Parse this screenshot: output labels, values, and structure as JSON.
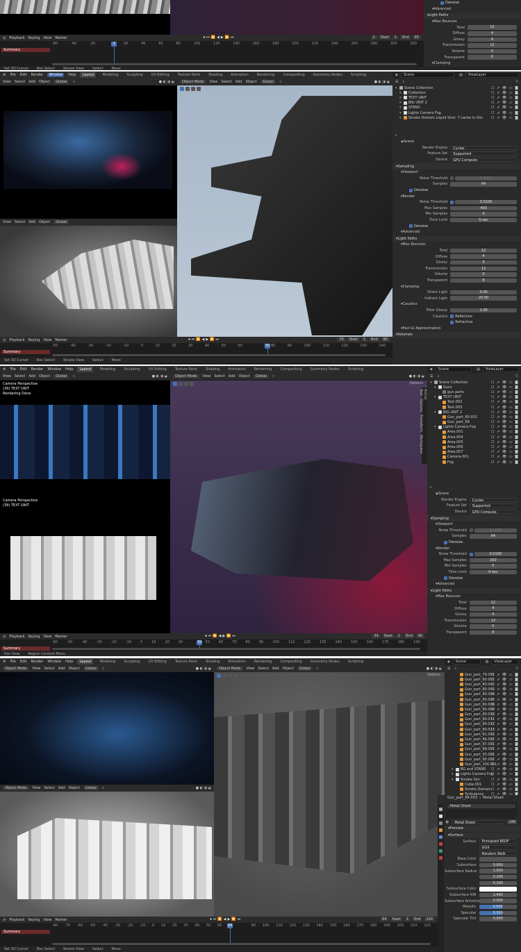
{
  "menu": [
    "File",
    "Edit",
    "Render",
    "Window",
    "Help"
  ],
  "workspaces": [
    "Layout",
    "Modeling",
    "Sculpting",
    "UV Editing",
    "Texture Paint",
    "Shading",
    "Animation",
    "Rendering",
    "Compositing",
    "Geometry Nodes",
    "Scripting"
  ],
  "header": {
    "view": "View",
    "select": "Select",
    "add": "Add",
    "object": "Object",
    "global": "Global",
    "object_mode": "Object Mode",
    "options": "Options",
    "scene": "Scene",
    "view_layer": "ViewLayer"
  },
  "timeline": {
    "playback": "Playback",
    "keying": "Keying",
    "view": "View",
    "marker": "Marker",
    "start_label": "Start",
    "end_label": "End",
    "summary": "Summary"
  },
  "status": {
    "set_3d_cursor": "Set 3D Cursor",
    "box_select": "Box Select",
    "rotate_view": "Rotate View",
    "select": "Select",
    "move": "Move",
    "pan_view": "Pan View",
    "region_context_menu": "Region Context Menu"
  },
  "colors": {
    "accent": "#4772b3",
    "summary": "#6b2a2a",
    "panel": "#2a2a2a"
  },
  "panels": [
    {
      "frame": {
        "current": "2",
        "start": "1",
        "end": "65"
      },
      "ticks": [
        "-60",
        "-40",
        "-20",
        "2",
        "20",
        "40",
        "60",
        "80",
        "100",
        "120",
        "140",
        "160",
        "180",
        "200",
        "220",
        "240",
        "260",
        "280",
        "300",
        "320"
      ],
      "current_fraction": 0.17,
      "props": [
        {
          "t": "chk",
          "label": "Denoise"
        },
        {
          "t": "sub",
          "label": "Advanced"
        },
        {
          "t": "sec",
          "label": "Light Paths"
        },
        {
          "t": "sub",
          "label": "Max Bounces"
        },
        {
          "t": "f",
          "label": "Total",
          "value": "12"
        },
        {
          "t": "f",
          "label": "Diffuse",
          "value": "4"
        },
        {
          "t": "f",
          "label": "Glossy",
          "value": "4"
        },
        {
          "t": "f",
          "label": "Transmission",
          "value": "12"
        },
        {
          "t": "f",
          "label": "Volume",
          "value": "0"
        },
        {
          "t": "f",
          "label": "Transparent",
          "value": "8"
        },
        {
          "t": "sub",
          "label": "Clamping"
        }
      ]
    },
    {
      "frame": {
        "current": "70",
        "start": "1",
        "end": "80"
      },
      "ticks": [
        "-50",
        "-40",
        "-30",
        "-20",
        "-10",
        "0",
        "10",
        "20",
        "30",
        "40",
        "50",
        "60",
        "70",
        "80",
        "90",
        "100",
        "110",
        "120",
        "130",
        "140"
      ],
      "current_fraction": 0.645,
      "outliner": [
        {
          "label": "Scene Collection",
          "lvl": 0,
          "ic": "#aaa"
        },
        {
          "label": "Collection",
          "lvl": 1,
          "ic": "#ddd"
        },
        {
          "label": "TEXT UNIT",
          "lvl": 1,
          "ic": "#ddd"
        },
        {
          "label": "BIG UNIT 2",
          "lvl": 1,
          "ic": "#ddd"
        },
        {
          "label": "STAND",
          "lvl": 1,
          "ic": "#ddd"
        },
        {
          "label": "Lights Camera Fog",
          "lvl": 1,
          "ic": "#ddd"
        },
        {
          "label": "Smoke Domain.Liquid Shot. T cache in this",
          "lvl": 1,
          "ic": "#e59a3a"
        }
      ],
      "props_title": "Scene",
      "props": [
        {
          "t": "d",
          "label": "Render Engine",
          "value": "Cycles"
        },
        {
          "t": "d",
          "label": "Feature Set",
          "value": "Supported"
        },
        {
          "t": "d",
          "label": "Device",
          "value": "GPU Compute"
        },
        {
          "t": "sec",
          "label": "Sampling"
        },
        {
          "t": "sub",
          "label": "Viewport"
        },
        {
          "t": "fc",
          "label": "Noise Threshold",
          "value": "0.1000",
          "on": false
        },
        {
          "t": "f",
          "label": "Samples",
          "value": "64"
        },
        {
          "t": "chk",
          "label": "Denoise"
        },
        {
          "t": "sub",
          "label": "Render"
        },
        {
          "t": "fc",
          "label": "Noise Threshold",
          "value": "0.0100",
          "on": true
        },
        {
          "t": "f",
          "label": "Max Samples",
          "value": "400"
        },
        {
          "t": "f",
          "label": "Min Samples",
          "value": "0"
        },
        {
          "t": "f",
          "label": "Time Limit",
          "value": "0 sec"
        },
        {
          "t": "chk",
          "label": "Denoise"
        },
        {
          "t": "sub",
          "label": "Advanced"
        },
        {
          "t": "sec",
          "label": "Light Paths"
        },
        {
          "t": "sub",
          "label": "Max Bounces"
        },
        {
          "t": "f",
          "label": "Total",
          "value": "12"
        },
        {
          "t": "f",
          "label": "Diffuse",
          "value": "4"
        },
        {
          "t": "f",
          "label": "Glossy",
          "value": "4"
        },
        {
          "t": "f",
          "label": "Transmission",
          "value": "12"
        },
        {
          "t": "f",
          "label": "Volume",
          "value": "0"
        },
        {
          "t": "f",
          "label": "Transparent",
          "value": "8"
        },
        {
          "t": "sub",
          "label": "Clamping"
        },
        {
          "t": "f",
          "label": "Direct Light",
          "value": "0.00"
        },
        {
          "t": "f",
          "label": "Indirect Light",
          "value": "20.00"
        },
        {
          "t": "sub",
          "label": "Caustics"
        },
        {
          "t": "f",
          "label": "Filter Glossy",
          "value": "1.00"
        },
        {
          "t": "c2",
          "label": "Caustics",
          "value": "Reflective"
        },
        {
          "t": "c2",
          "label": "",
          "value": "Refractive"
        },
        {
          "t": "sub",
          "label": "Fast GI Approximation"
        },
        {
          "t": "sec",
          "label": "Volumes"
        }
      ]
    },
    {
      "frame": {
        "current": "39",
        "start": "1",
        "end": "90"
      },
      "ticks": [
        "-60",
        "-50",
        "-40",
        "-30",
        "-20",
        "-10",
        "0",
        "10",
        "20",
        "30",
        "39",
        "50",
        "60",
        "70",
        "80",
        "90",
        "100",
        "110",
        "120",
        "130",
        "140",
        "150",
        "160",
        "170",
        "180",
        "190"
      ],
      "current_fraction": 0.4,
      "overlay_top": [
        "Camera Perspective",
        "(39) TEXT UNIT",
        "Rendering Done"
      ],
      "overlay_bottom": [
        "Camera Perspective",
        "(39) TEXT UNIT"
      ],
      "sidebar_tabs": [
        "Active Tool",
        "Options",
        "Transform",
        "Workspace"
      ],
      "outliner": [
        {
          "label": "Scene Collection",
          "lvl": 0,
          "ic": "#aaa"
        },
        {
          "label": "Guns",
          "lvl": 1,
          "ic": "#ddd"
        },
        {
          "label": "gun parts",
          "lvl": 2,
          "ic": "#777"
        },
        {
          "label": "TEXT UNIT",
          "lvl": 1,
          "ic": "#ddd"
        },
        {
          "label": "Text.002",
          "lvl": 2,
          "ic": "#e59a3a"
        },
        {
          "label": "Text.003",
          "lvl": 2,
          "ic": "#e59a3a"
        },
        {
          "label": "BIG UNIT 2",
          "lvl": 1,
          "ic": "#ddd"
        },
        {
          "label": "Gun_part_80.001",
          "lvl": 2,
          "ic": "#e59a3a"
        },
        {
          "label": "Gun_part_69",
          "lvl": 2,
          "ic": "#e59a3a"
        },
        {
          "label": "Lights Camera Fog",
          "lvl": 1,
          "ic": "#ddd"
        },
        {
          "label": "Area.001",
          "lvl": 2,
          "ic": "#e59a3a"
        },
        {
          "label": "Area.004",
          "lvl": 2,
          "ic": "#e59a3a"
        },
        {
          "label": "Area.005",
          "lvl": 2,
          "ic": "#e59a3a"
        },
        {
          "label": "Area.006",
          "lvl": 2,
          "ic": "#e59a3a"
        },
        {
          "label": "Area.007",
          "lvl": 2,
          "ic": "#e59a3a"
        },
        {
          "label": "Camera.001",
          "lvl": 2,
          "ic": "#e59a3a"
        },
        {
          "label": "Fog",
          "lvl": 2,
          "ic": "#e59a3a"
        }
      ],
      "props_title": "Scene",
      "props": [
        {
          "t": "d",
          "label": "Render Engine",
          "value": "Cycles"
        },
        {
          "t": "d",
          "label": "Feature Set",
          "value": "Supported"
        },
        {
          "t": "d",
          "label": "Device",
          "value": "GPU Compute"
        },
        {
          "t": "sec",
          "label": "Sampling"
        },
        {
          "t": "sub",
          "label": "Viewport"
        },
        {
          "t": "fc",
          "label": "Noise Threshold",
          "value": "0.1000",
          "on": false
        },
        {
          "t": "f",
          "label": "Samples",
          "value": "64"
        },
        {
          "t": "chk",
          "label": "Denoise"
        },
        {
          "t": "sub",
          "label": "Render"
        },
        {
          "t": "fc",
          "label": "Noise Threshold",
          "value": "0.0100",
          "on": true
        },
        {
          "t": "f",
          "label": "Max Samples",
          "value": "200"
        },
        {
          "t": "f",
          "label": "Min Samples",
          "value": "0"
        },
        {
          "t": "f",
          "label": "Time Limit",
          "value": "0 sec"
        },
        {
          "t": "chk",
          "label": "Denoise"
        },
        {
          "t": "sub",
          "label": "Advanced"
        },
        {
          "t": "sec",
          "label": "Light Paths"
        },
        {
          "t": "sub",
          "label": "Max Bounces"
        },
        {
          "t": "f",
          "label": "Total",
          "value": "12"
        },
        {
          "t": "f",
          "label": "Diffuse",
          "value": "4"
        },
        {
          "t": "f",
          "label": "Glossy",
          "value": "4"
        },
        {
          "t": "f",
          "label": "Transmission",
          "value": "12"
        },
        {
          "t": "f",
          "label": "Volume",
          "value": "0"
        },
        {
          "t": "f",
          "label": "Transparent",
          "value": "8"
        }
      ]
    },
    {
      "frame": {
        "current": "84",
        "start": "1",
        "end": "220"
      },
      "ticks": [
        "-80",
        "-70",
        "-60",
        "-50",
        "-40",
        "-30",
        "-20",
        "-10",
        "0",
        "10",
        "20",
        "30",
        "40",
        "50",
        "60",
        "70",
        "84",
        "90",
        "100",
        "110",
        "120",
        "130",
        "140",
        "150",
        "160",
        "170",
        "180",
        "190",
        "200",
        "210",
        "220"
      ],
      "current_fraction": 0.47,
      "outliner": [
        {
          "label": "Gun_part_79.001",
          "lvl": 2,
          "ic": "#e59a3a"
        },
        {
          "label": "Gun_part_80.001",
          "lvl": 2,
          "ic": "#e59a3a"
        },
        {
          "label": "Gun_part_80.002",
          "lvl": 2,
          "ic": "#e59a3a"
        },
        {
          "label": "Gun_part_80.003",
          "lvl": 2,
          "ic": "#e59a3a"
        },
        {
          "label": "Gun_part_80.004",
          "lvl": 2,
          "ic": "#e59a3a"
        },
        {
          "label": "Gun_part_80.005",
          "lvl": 2,
          "ic": "#e59a3a"
        },
        {
          "label": "Gun_part_80.006",
          "lvl": 2,
          "ic": "#e59a3a"
        },
        {
          "label": "Gun_part_80.009",
          "lvl": 2,
          "ic": "#e59a3a"
        },
        {
          "label": "Gun_part_80.010",
          "lvl": 2,
          "ic": "#e59a3a"
        },
        {
          "label": "Gun_part_80.011",
          "lvl": 2,
          "ic": "#e59a3a"
        },
        {
          "label": "Gun_part_80.012",
          "lvl": 2,
          "ic": "#e59a3a"
        },
        {
          "label": "Gun_part_80.013",
          "lvl": 2,
          "ic": "#e59a3a"
        },
        {
          "label": "Gun_part_81.001",
          "lvl": 2,
          "ic": "#e59a3a"
        },
        {
          "label": "Gun_part_86.002",
          "lvl": 2,
          "ic": "#e59a3a"
        },
        {
          "label": "Gun_part_87.001",
          "lvl": 2,
          "ic": "#e59a3a"
        },
        {
          "label": "Gun_part_88.001",
          "lvl": 2,
          "ic": "#e59a3a"
        },
        {
          "label": "Gun_part_93.001",
          "lvl": 2,
          "ic": "#e59a3a"
        },
        {
          "label": "Gun_part_95.001",
          "lvl": 2,
          "ic": "#e59a3a"
        },
        {
          "label": "Gun_part_100.001",
          "lvl": 2,
          "ic": "#e59a3a"
        },
        {
          "label": "BG and STAND",
          "lvl": 1,
          "ic": "#ddd"
        },
        {
          "label": "Lights Camera Fog",
          "lvl": 1,
          "ic": "#ddd"
        },
        {
          "label": "Smoke Sim",
          "lvl": 1,
          "ic": "#ddd"
        },
        {
          "label": "Cube.001",
          "lvl": 2,
          "ic": "#e59a3a"
        },
        {
          "label": "Smoke Domain",
          "lvl": 2,
          "ic": "#e59a3a"
        },
        {
          "label": "Turbulence",
          "lvl": 2,
          "ic": "#e59a3a"
        }
      ],
      "breadcrumb": {
        "object": "Gun_part_84.003",
        "material": "Metal Sheet"
      },
      "material_slot": "Metal Sheet",
      "material_name": "Metal Sheet",
      "material_users": "148",
      "props": [
        {
          "t": "sec",
          "label": "Preview"
        },
        {
          "t": "sec",
          "label": "Surface"
        },
        {
          "t": "d",
          "label": "Surface",
          "value": "Principled BSDF"
        },
        {
          "t": "d",
          "label": "",
          "value": "GGX"
        },
        {
          "t": "d",
          "label": "",
          "value": "Random Walk"
        },
        {
          "t": "f",
          "label": "Base Color",
          "value": ""
        },
        {
          "t": "f",
          "label": "Subsurface",
          "value": "0.000"
        },
        {
          "t": "f",
          "label": "Subsurface Radius",
          "value": "1.000"
        },
        {
          "t": "f",
          "label": "",
          "value": "0.200"
        },
        {
          "t": "f",
          "label": "",
          "value": "0.100"
        },
        {
          "t": "w",
          "label": "Subsurface Color",
          "value": ""
        },
        {
          "t": "f",
          "label": "Subsurface IOR",
          "value": "1.400"
        },
        {
          "t": "f",
          "label": "Subsurface Anisotropy",
          "value": "0.000"
        },
        {
          "t": "b",
          "label": "Metallic",
          "value": "0.935"
        },
        {
          "t": "b",
          "label": "Specular",
          "value": "0.500"
        },
        {
          "t": "f",
          "label": "Specular Tint",
          "value": "0.000"
        }
      ]
    }
  ]
}
